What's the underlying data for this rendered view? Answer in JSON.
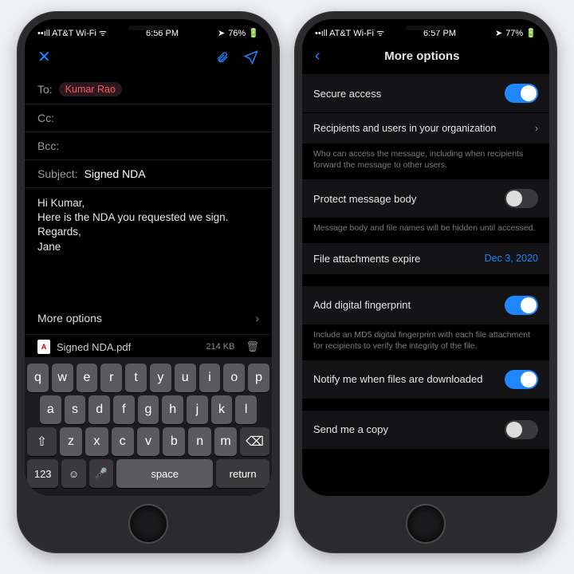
{
  "left": {
    "status": {
      "carrier": "AT&T Wi-Fi",
      "time": "6:56 PM",
      "battery": "76%"
    },
    "fields": {
      "to_label": "To:",
      "to_chip": "Kumar Rao",
      "cc_label": "Cc:",
      "bcc_label": "Bcc:",
      "subject_label": "Subject:",
      "subject_value": "Signed NDA"
    },
    "body": "Hi Kumar,\nHere is the NDA you requested we sign.\nRegards,\nJane",
    "more_options": "More options",
    "attachment": {
      "name": "Signed NDA.pdf",
      "size": "214 KB"
    },
    "keyboard": {
      "row1": [
        "q",
        "w",
        "e",
        "r",
        "t",
        "y",
        "u",
        "i",
        "o",
        "p"
      ],
      "row2": [
        "a",
        "s",
        "d",
        "f",
        "g",
        "h",
        "j",
        "k",
        "l"
      ],
      "row3": [
        "z",
        "x",
        "c",
        "v",
        "b",
        "n",
        "m"
      ],
      "n123": "123",
      "space": "space",
      "return": "return"
    }
  },
  "right": {
    "status": {
      "carrier": "AT&T Wi-Fi",
      "time": "6:57 PM",
      "battery": "77%"
    },
    "title": "More options",
    "rows": {
      "secure_access": "Secure access",
      "recipients": "Recipients and users in your organization",
      "hint1": "Who can access the message, including when recipients forward the message to other users.",
      "protect": "Protect message body",
      "hint2": "Message body and file names will be hidden until accessed.",
      "expire": "File attachments expire",
      "expire_value": "Dec 3, 2020",
      "fingerprint": "Add digital fingerprint",
      "hint3": "Include an MD5 digital fingerprint with each file attachment for recipients to verify the integrity of the file.",
      "notify": "Notify me when files are downloaded",
      "copy": "Send me a copy"
    }
  }
}
